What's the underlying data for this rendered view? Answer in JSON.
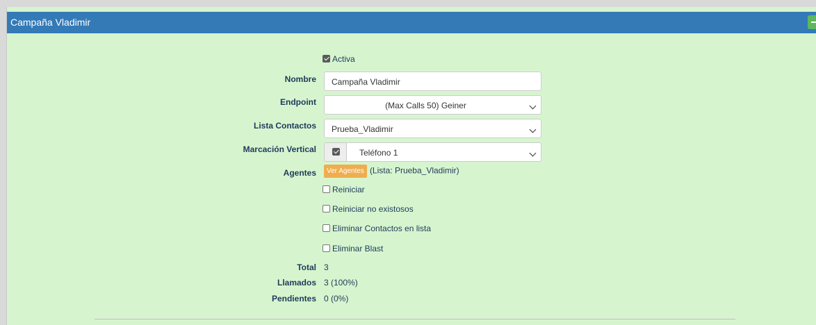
{
  "panel": {
    "title": "Campaña Vladimir"
  },
  "form": {
    "activa": {
      "label": "Activa",
      "checked": true
    },
    "nombre": {
      "label": "Nombre",
      "value": "Campaña Vladimir"
    },
    "endpoint": {
      "label": "Endpoint",
      "value": "(Max Calls 50) Geiner"
    },
    "lista_contactos": {
      "label": "Lista Contactos",
      "value": "Prueba_Vladimir"
    },
    "marcacion_vertical": {
      "label": "Marcación Vertical",
      "checked": true,
      "value": "Teléfono 1"
    },
    "agentes": {
      "label": "Agentes",
      "button": "Ver Agentes",
      "info": "(Lista: Prueba_Vladimir)"
    },
    "reiniciar": {
      "label": "Reiniciar",
      "checked": false
    },
    "reiniciar_no_exitosos": {
      "label": "Reiniciar no existosos",
      "checked": false
    },
    "eliminar_contactos": {
      "label": "Eliminar Contactos en lista",
      "checked": false
    },
    "eliminar_blast": {
      "label": "Eliminar Blast",
      "checked": false
    }
  },
  "stats": {
    "total": {
      "label": "Total",
      "value": "3"
    },
    "llamados": {
      "label": "Llamados",
      "value": "3 (100%)"
    },
    "pendientes": {
      "label": "Pendientes",
      "value": "0 (0%)"
    }
  },
  "colors": {
    "header": "#337ab7",
    "panel_bg": "#d6f5cf",
    "agents_button": "#f0ad4e",
    "collapse_button": "#5cb85c",
    "label_text": "#1f3a5a"
  },
  "icons": {
    "collapse": "minus-icon",
    "dropdown": "chevron-down-icon"
  }
}
